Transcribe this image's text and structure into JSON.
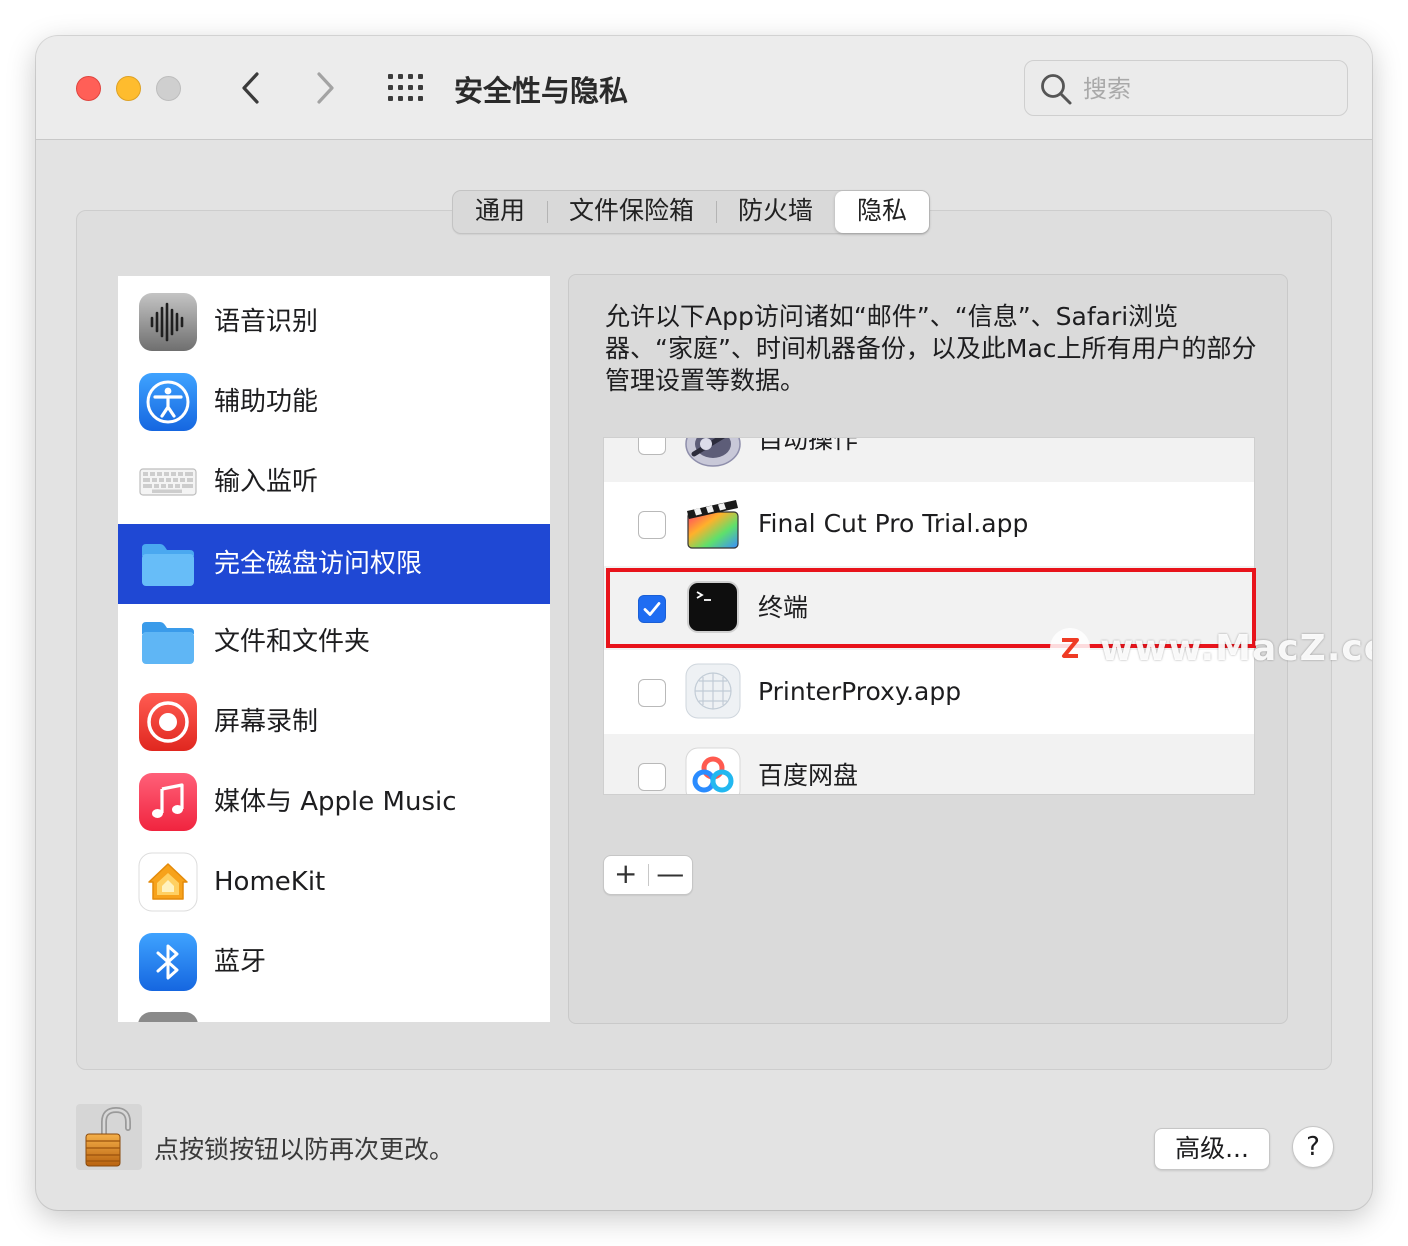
{
  "window": {
    "title": "安全性与隐私"
  },
  "toolbar": {
    "back_icon": "chevron-left-icon",
    "forward_icon": "chevron-right-icon",
    "grid_icon": "grid-icon"
  },
  "search": {
    "placeholder": "搜索",
    "value": ""
  },
  "tabs": [
    {
      "label": "通用",
      "active": false
    },
    {
      "label": "文件保险箱",
      "active": false
    },
    {
      "label": "防火墙",
      "active": false
    },
    {
      "label": "隐私",
      "active": true
    }
  ],
  "sidebar": {
    "items": [
      {
        "label": "语音识别",
        "icon": "waveform-icon",
        "selected": false
      },
      {
        "label": "辅助功能",
        "icon": "accessibility-icon",
        "selected": false
      },
      {
        "label": "输入监听",
        "icon": "keyboard-icon",
        "selected": false
      },
      {
        "label": "完全磁盘访问权限",
        "icon": "folder-icon",
        "selected": true
      },
      {
        "label": "文件和文件夹",
        "icon": "folder-icon",
        "selected": false
      },
      {
        "label": "屏幕录制",
        "icon": "screen-record-icon",
        "selected": false
      },
      {
        "label": "媒体与 Apple Music",
        "icon": "music-icon",
        "selected": false
      },
      {
        "label": "HomeKit",
        "icon": "home-icon",
        "selected": false
      },
      {
        "label": "蓝牙",
        "icon": "bluetooth-icon",
        "selected": false
      }
    ]
  },
  "content": {
    "description": "允许以下App访问诸如“邮件”、“信息”、Safari浏览器、“家庭”、时间机器备份，以及此Mac上所有用户的部分管理设置等数据。",
    "apps": [
      {
        "name": "自动操作",
        "checked": false,
        "icon": "automator-icon"
      },
      {
        "name": "Final Cut Pro Trial.app",
        "checked": false,
        "icon": "final-cut-pro-icon"
      },
      {
        "name": "终端",
        "checked": true,
        "icon": "terminal-icon"
      },
      {
        "name": "PrinterProxy.app",
        "checked": false,
        "icon": "printer-proxy-icon"
      },
      {
        "name": "百度网盘",
        "checked": false,
        "icon": "baidu-netdisk-icon"
      }
    ],
    "add_label": "+",
    "remove_label": "—"
  },
  "watermark": {
    "text": "www.MacZ.com"
  },
  "footer": {
    "lock_text": "点按锁按钮以防再次更改。",
    "advanced_label": "高级...",
    "help_label": "?"
  },
  "colors": {
    "selected_row": "#1f48d4",
    "checkbox_checked": "#1f6df2",
    "highlight_border": "#e8131b",
    "close": "#ff5f57",
    "minimize": "#febc2e"
  }
}
